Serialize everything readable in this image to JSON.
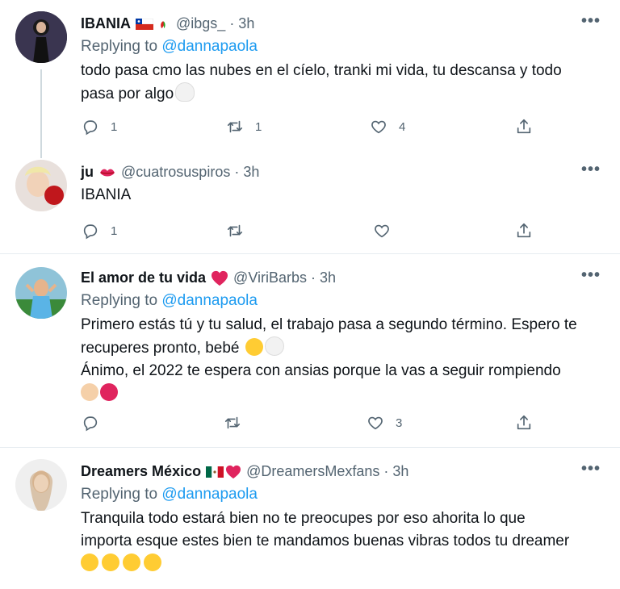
{
  "tweets": [
    {
      "name": "IBANIA",
      "handle": "@ibgs_",
      "time": "· 3h",
      "reply_prefix": "Replying to",
      "reply_handle": "@dannapaola",
      "text_lines": [
        "todo pasa cmo las nubes en el cíelo, tranki mi vida, tu descansa y todo",
        "pasa por algo"
      ],
      "counts": {
        "reply": "1",
        "retweet": "1",
        "like": "4"
      }
    },
    {
      "name": "ju",
      "handle": "@cuatrosuspiros",
      "time": "· 3h",
      "text_lines": [
        "IBANIA"
      ],
      "counts": {
        "reply": "1",
        "retweet": "",
        "like": ""
      }
    },
    {
      "name": "El amor de tu vida",
      "handle": "@ViriBarbs",
      "time": "· 3h",
      "reply_prefix": "Replying to",
      "reply_handle": "@dannapaola",
      "text_lines": [
        "Primero estás tú y tu salud, el trabajo pasa a segundo término. Espero te",
        "recuperes pronto, bebé",
        "Ánimo, el 2022 te espera con ansias porque la vas a seguir rompiendo"
      ],
      "counts": {
        "reply": "",
        "retweet": "",
        "like": "3"
      }
    },
    {
      "name": "Dreamers México",
      "handle": "@DreamersMexfans",
      "time": "· 3h",
      "reply_prefix": "Replying to",
      "reply_handle": "@dannapaola",
      "text_lines": [
        "Tranquila todo estará bien no te preocupes por eso ahorita lo que",
        "importa esque estes bien te mandamos buenas vibras todos tu dreamer"
      ]
    }
  ],
  "more_label": "•••",
  "icons": [
    "reply-icon",
    "retweet-icon",
    "like-icon",
    "share-icon",
    "more-icon"
  ],
  "colors": {
    "link": "#1d9bf0",
    "muted": "#536471",
    "divider": "#e6ecf0",
    "heart": "#e0245e"
  }
}
